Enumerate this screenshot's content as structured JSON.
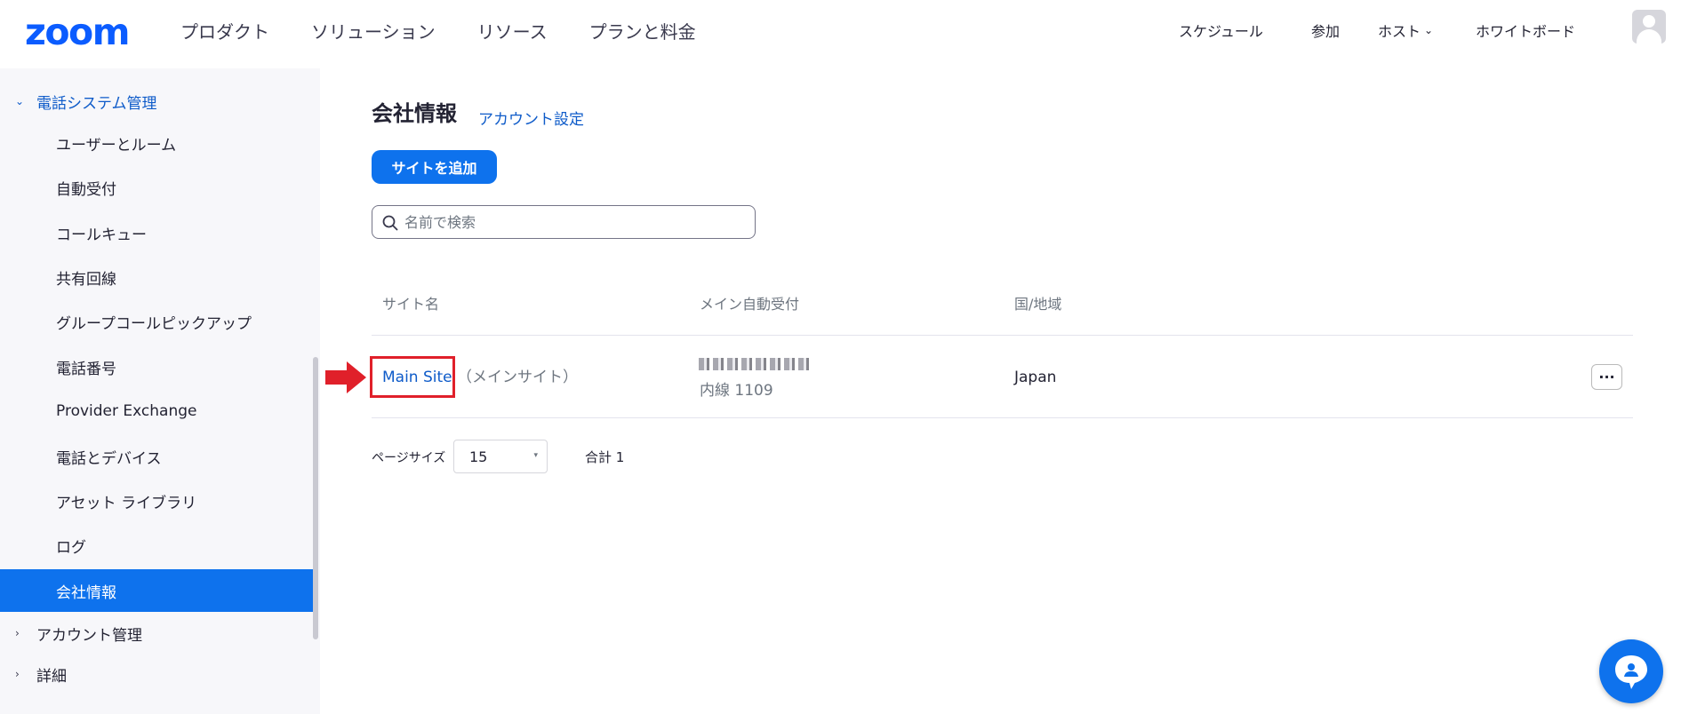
{
  "header": {
    "logo": "zoom",
    "nav_left": [
      "プロダクト",
      "ソリューション",
      "リソース",
      "プランと料金"
    ],
    "schedule": "スケジュール",
    "join": "参加",
    "host": "ホスト",
    "whiteboard": "ホワイトボード"
  },
  "sidebar": {
    "phone_section": "電話システム管理",
    "items": [
      "ユーザーとルーム",
      "自動受付",
      "コールキュー",
      "共有回線",
      "グループコールピックアップ",
      "電話番号",
      "Provider Exchange",
      "電話とデバイス",
      "アセット ライブラリ",
      "ログ",
      "会社情報"
    ],
    "active_item": "会社情報",
    "account_section": "アカウント管理",
    "details_section": "詳細"
  },
  "main": {
    "title": "会社情報",
    "account_link": "アカウント設定",
    "add_site_button": "サイトを追加",
    "search_placeholder": "名前で検索",
    "table": {
      "headers": [
        "サイト名",
        "メイン自動受付",
        "国/地域"
      ],
      "rows": [
        {
          "site_name": "Main Site",
          "site_note": "（メインサイト）",
          "extension": "内線 1109",
          "country": "Japan",
          "more": "···"
        }
      ]
    },
    "pagination": {
      "page_size_label": "ページサイズ",
      "page_size": "15",
      "total": "合計 1"
    }
  },
  "colors": {
    "brand": "#0b5cff",
    "primary": "#0e72ed",
    "link": "#0e5bc9",
    "highlight": "#e0202a"
  },
  "icons": [
    "search-icon",
    "chevron-down-icon",
    "chevron-right-icon",
    "avatar-icon",
    "more-icon",
    "chat-icon",
    "arrow-icon"
  ]
}
